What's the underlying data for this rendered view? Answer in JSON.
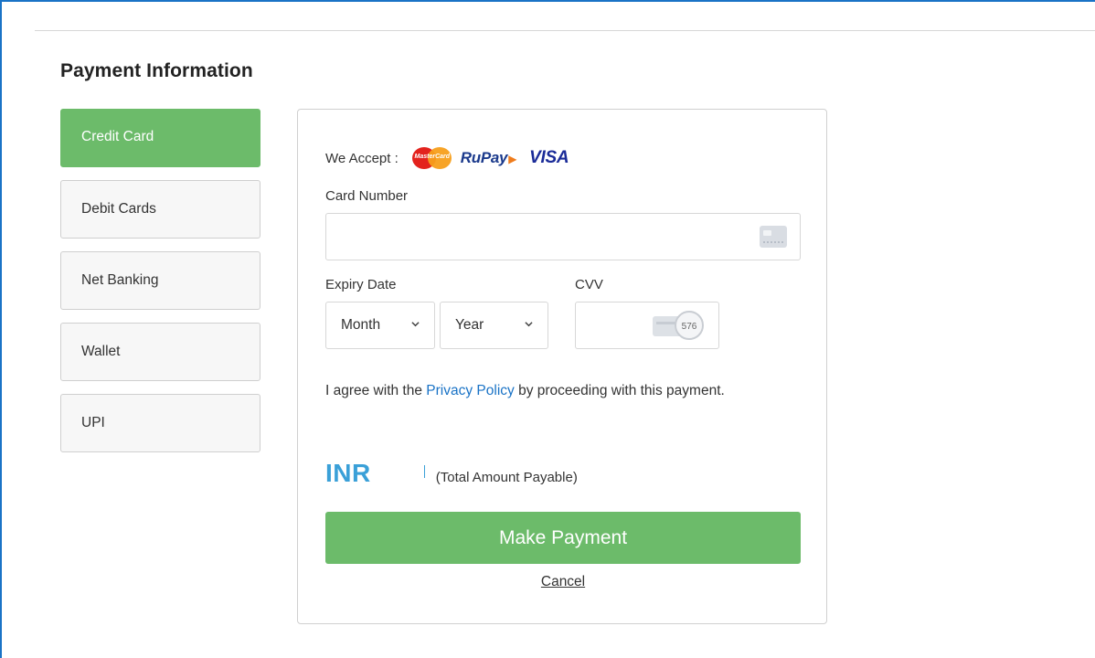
{
  "page": {
    "title": "Payment Information"
  },
  "payment_methods": [
    {
      "label": "Credit Card",
      "active": true
    },
    {
      "label": "Debit Cards",
      "active": false
    },
    {
      "label": "Net Banking",
      "active": false
    },
    {
      "label": "Wallet",
      "active": false
    },
    {
      "label": "UPI",
      "active": false
    }
  ],
  "form": {
    "accept_label": "We Accept :",
    "accepted_cards": {
      "mastercard_text": "MasterCard",
      "rupay": "RuPay",
      "visa": "VISA"
    },
    "card_number_label": "Card Number",
    "card_number_value": "",
    "expiry_label": "Expiry Date",
    "month_selected": "Month",
    "year_selected": "Year",
    "cvv_label": "CVV",
    "cvv_value": "",
    "cvv_icon_text": "576",
    "agree_prefix": "I agree with the ",
    "privacy_link": "Privacy Policy",
    "agree_suffix": " by proceeding with this payment.",
    "currency": "INR",
    "amount": "",
    "amount_note": "(Total Amount Payable)",
    "submit_label": "Make Payment",
    "cancel_label": "Cancel"
  },
  "colors": {
    "accent_green": "#6cbb6a",
    "link_blue": "#1a73c6",
    "currency_blue": "#3aa0d8",
    "frame_blue": "#1a73c6"
  }
}
